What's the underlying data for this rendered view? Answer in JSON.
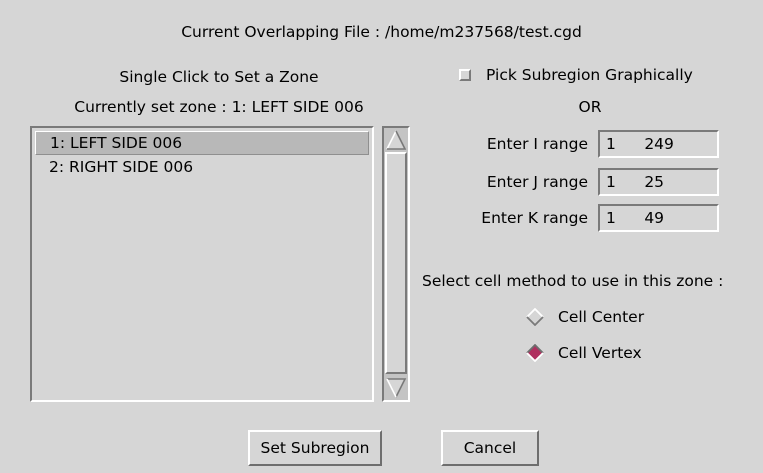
{
  "dialog": {
    "file_title": "Current Overlapping File : /home/m237568/test.cgd"
  },
  "zones": {
    "instruction": "Single Click to Set a Zone",
    "current_zone": "Currently set zone : 1: LEFT SIDE 006",
    "items": [
      {
        "label": "1: LEFT SIDE 006",
        "selected": true
      },
      {
        "label": "2: RIGHT SIDE 006",
        "selected": false
      }
    ]
  },
  "subregion": {
    "pick_label": "Pick Subregion Graphically",
    "pick_checked": false,
    "or_label": "OR",
    "i_label": "Enter I range",
    "i_value": "1  249",
    "j_label": "Enter J range",
    "j_value": "1  25",
    "k_label": "Enter K range",
    "k_value": "1  49"
  },
  "cell_method": {
    "label": "Select cell method to use in this zone :",
    "options": [
      {
        "label": "Cell Center",
        "selected": false
      },
      {
        "label": "Cell Vertex",
        "selected": true
      }
    ]
  },
  "buttons": {
    "set_subregion": "Set Subregion",
    "cancel": "Cancel"
  },
  "colors": {
    "background": "#d6d6d6",
    "radio_selected": "#b03060"
  },
  "icons": {
    "scroll_up": "arrow-up-icon",
    "scroll_down": "arrow-down-icon",
    "radio": "diamond-radio-icon"
  }
}
